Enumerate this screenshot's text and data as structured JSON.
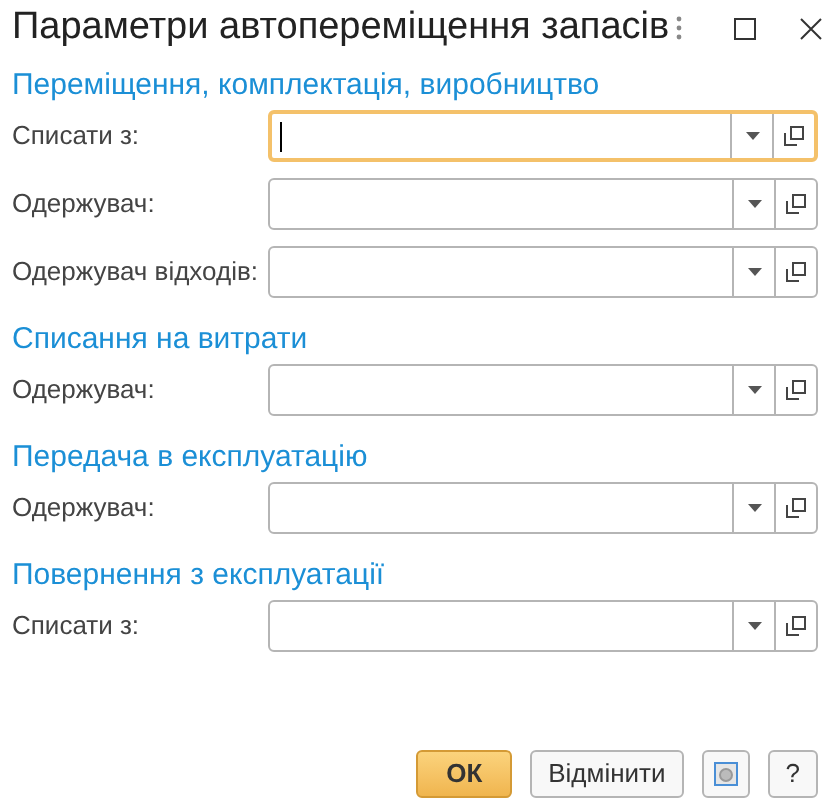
{
  "window": {
    "title": "Параметри автопереміщення запасів"
  },
  "sections": [
    {
      "heading": "Переміщення, комплектація, виробництво",
      "fields": [
        {
          "label": "Списати з:",
          "focused": true
        },
        {
          "label": "Одержувач:",
          "focused": false
        },
        {
          "label": "Одержувач відходів:",
          "focused": false
        }
      ]
    },
    {
      "heading": "Списання на витрати",
      "fields": [
        {
          "label": "Одержувач:",
          "focused": false
        }
      ]
    },
    {
      "heading": "Передача в експлуатацію",
      "fields": [
        {
          "label": "Одержувач:",
          "focused": false
        }
      ]
    },
    {
      "heading": "Повернення з експлуатації",
      "fields": [
        {
          "label": "Списати з:",
          "focused": false
        }
      ]
    }
  ],
  "buttons": [
    {
      "kind": "primary",
      "label": "ОК"
    },
    {
      "kind": "secondary",
      "label": "Відмінити"
    },
    {
      "kind": "icon"
    },
    {
      "kind": "secondary",
      "label": "?"
    }
  ]
}
